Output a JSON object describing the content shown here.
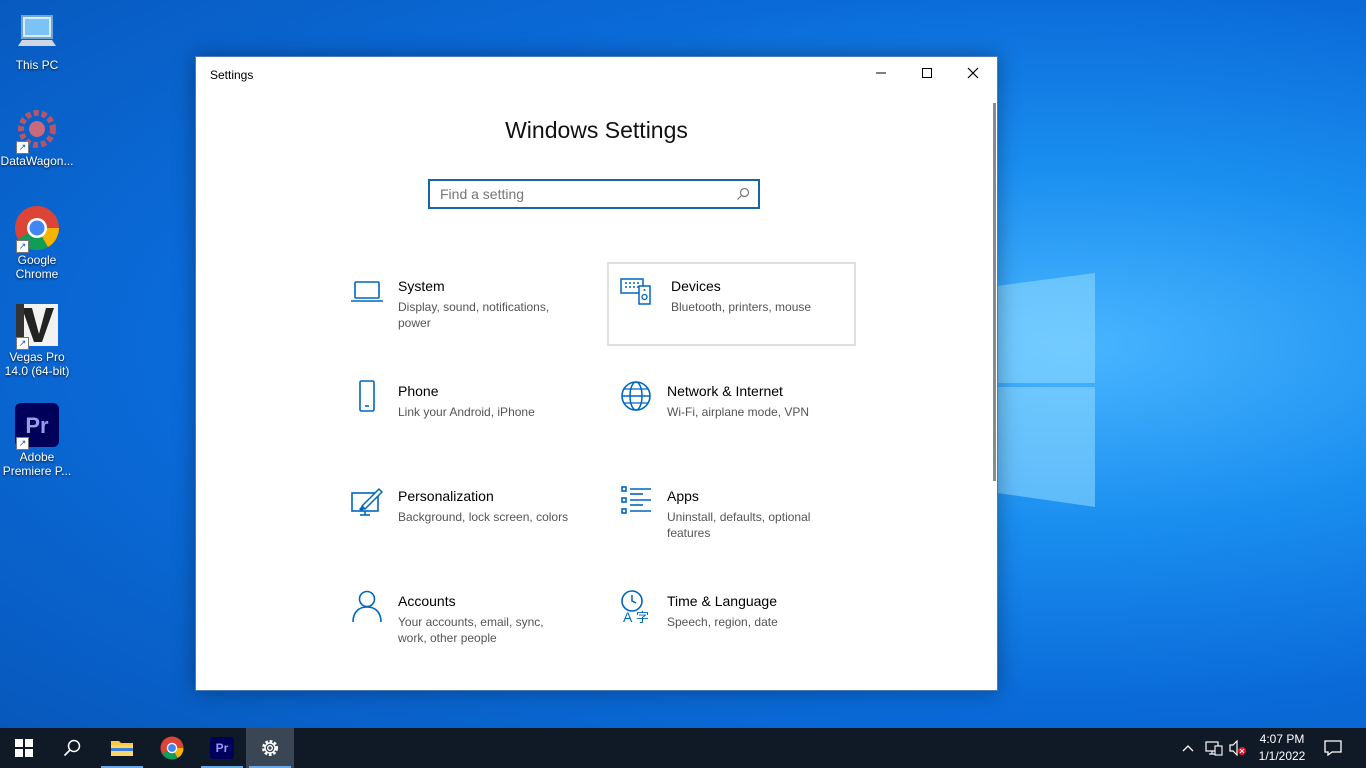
{
  "desktop": {
    "icons": [
      {
        "label": "This PC"
      },
      {
        "label": "DataWagon..."
      },
      {
        "label": "Google Chrome"
      },
      {
        "label": "Vegas Pro 14.0 (64-bit)"
      },
      {
        "label": "Adobe Premiere P..."
      }
    ]
  },
  "window": {
    "title": "Settings",
    "heading": "Windows Settings",
    "search_placeholder": "Find a setting",
    "tiles": [
      {
        "name": "System",
        "desc": "Display, sound, notifications, power",
        "icon": "laptop-icon"
      },
      {
        "name": "Devices",
        "desc": "Bluetooth, printers, mouse",
        "icon": "devices-icon"
      },
      {
        "name": "Phone",
        "desc": "Link your Android, iPhone",
        "icon": "phone-icon"
      },
      {
        "name": "Network & Internet",
        "desc": "Wi-Fi, airplane mode, VPN",
        "icon": "globe-icon"
      },
      {
        "name": "Personalization",
        "desc": "Background, lock screen, colors",
        "icon": "paintbrush-icon"
      },
      {
        "name": "Apps",
        "desc": "Uninstall, defaults, optional features",
        "icon": "apps-list-icon"
      },
      {
        "name": "Accounts",
        "desc": "Your accounts, email, sync, work, other people",
        "icon": "person-icon"
      },
      {
        "name": "Time & Language",
        "desc": "Speech, region, date",
        "icon": "time-language-icon"
      }
    ]
  },
  "taskbar": {
    "time": "4:07 PM",
    "date": "1/1/2022",
    "premiere_label": "Pr"
  },
  "colors": {
    "accent": "#0067c0",
    "taskbar": "#101a26"
  }
}
